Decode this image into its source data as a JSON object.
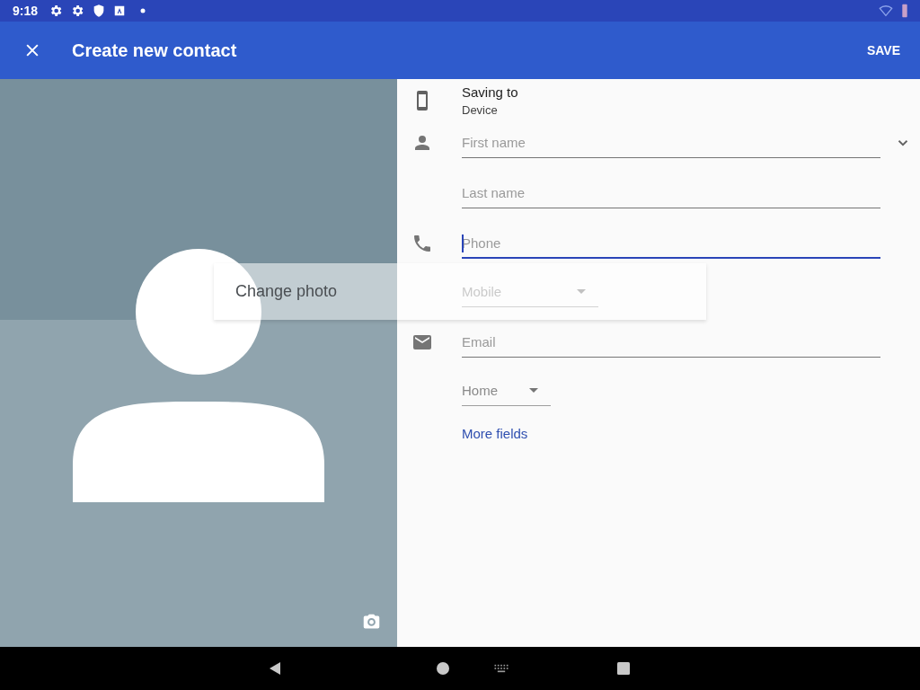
{
  "status_bar": {
    "time": "9:18"
  },
  "app_bar": {
    "title": "Create new contact",
    "action": "SAVE"
  },
  "photo": {
    "tooltip": "Change photo"
  },
  "saving_to": {
    "label": "Saving to",
    "account": "Device"
  },
  "name": {
    "fields": [
      {
        "placeholder": "First name",
        "focused": false
      },
      {
        "placeholder": "Last name",
        "focused": false
      }
    ]
  },
  "phone": {
    "fields": [
      {
        "placeholder": "Phone",
        "focused": true
      }
    ],
    "type": "Mobile"
  },
  "email": {
    "fields": [
      {
        "placeholder": "Email",
        "focused": false
      }
    ],
    "type": "Home"
  },
  "more_fields": "More fields"
}
